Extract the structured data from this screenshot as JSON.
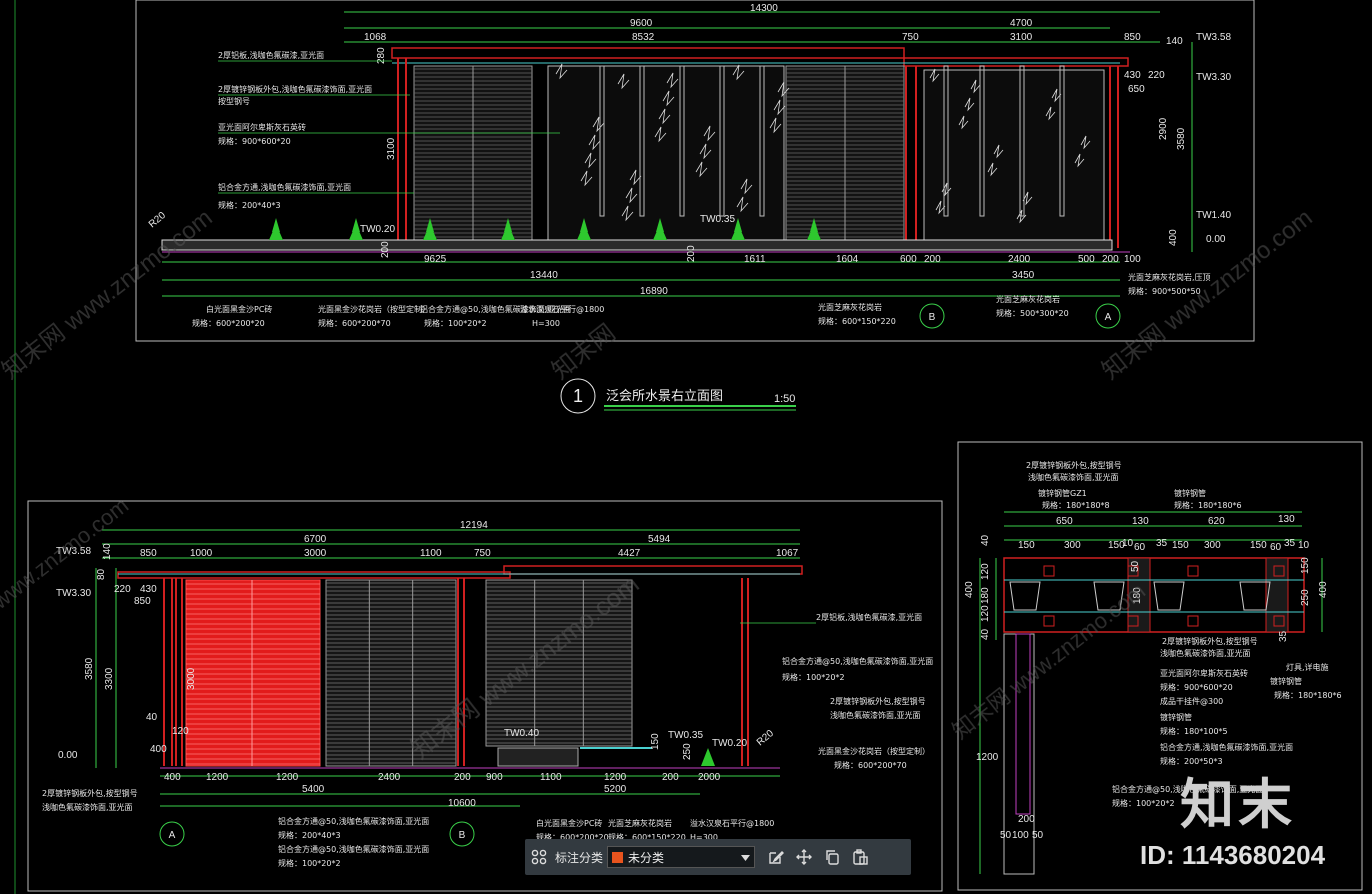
{
  "drawing": {
    "view1": {
      "number": "1",
      "title": "泛会所水景右立面图",
      "scale": "1:50",
      "top_dims": [
        "14300",
        "9600",
        "4700",
        "1068",
        "8532",
        "750",
        "3100",
        "850",
        "140"
      ],
      "levels": [
        "TW3.58",
        "TW3.30",
        "TW1.40",
        "0.00",
        "TW0.20",
        "TW0.35"
      ],
      "side_dims": [
        "3580",
        "2900",
        "430",
        "220",
        "650",
        "400",
        "3100",
        "280"
      ],
      "bottom_dims": [
        "9625",
        "1611",
        "1604",
        "600",
        "200",
        "2400",
        "500",
        "200",
        "13440",
        "3450",
        "16890",
        "100",
        "200",
        "200",
        "R20"
      ],
      "notes": [
        "2厚铝板,浅咖色氟碳漆,亚光面",
        "2厚镀锌钢板外包,浅咖色氟碳漆饰面,亚光面",
        "按型钢号",
        "亚光面阿尔卑斯灰石英砖",
        "规格：900*600*20",
        "铝合金方通,浅咖色氟碳漆饰面,亚光面",
        "规格：200*40*3",
        "白光面黑金沙PC砖",
        "规格：600*200*20",
        "光面黑金沙花岗岩（按型定制）",
        "规格：600*200*70",
        "铝合金方通@50,浅咖色氟碳漆饰面,亚光面",
        "规格：100*20*2",
        "溢水汉泉石平行@1800",
        "H=300",
        "光面芝麻灰花岗岩",
        "规格：600*150*220",
        "光面芝麻灰花岗岩",
        "规格：500*300*20",
        "光面芝麻灰花岗岩,压顶",
        "规格：900*500*50"
      ],
      "axes": [
        "B",
        "A"
      ]
    },
    "view2": {
      "top_dims": [
        "12194",
        "6700",
        "5494",
        "850",
        "1000",
        "3000",
        "1100",
        "750",
        "4427",
        "1067",
        "140",
        "80",
        "220",
        "430",
        "850"
      ],
      "levels": [
        "TW3.58",
        "TW3.30",
        "0.00",
        "TW0.40",
        "TW0.35",
        "TW0.20"
      ],
      "side_dims": [
        "3580",
        "3300",
        "3000",
        "400",
        "120",
        "40",
        "150",
        "250"
      ],
      "bottom_dims": [
        "400",
        "1200",
        "1200",
        "2400",
        "200",
        "900",
        "1100",
        "1200",
        "200",
        "2000",
        "5400",
        "5200",
        "10600",
        "R20"
      ],
      "notes": [
        "2厚镀锌钢板外包,按型钢号",
        "浅咖色氟碳漆饰面,亚光面",
        "铝合金方通@50,浅咖色氟碳漆饰面,亚光面",
        "规格：200*40*3",
        "铝合金方通@50,浅咖色氟碳漆饰面,亚光面",
        "规格：100*20*2",
        "白光面黑金沙PC砖",
        "规格：600*200*20",
        "光面芝麻灰花岗岩",
        "规格：600*150*220",
        "溢水汉泉石平行@1800",
        "H=300",
        "2厚铝板,浅咖色氟碳漆,亚光面",
        "铝合金方通@50,浅咖色氟碳漆饰面,亚光面",
        "规格：100*20*2",
        "2厚镀锌钢板外包,按型钢号",
        "浅咖色氟碳漆饰面,亚光面",
        "光面黑金沙花岗岩（按型定制）",
        "规格：600*200*70"
      ],
      "axes": [
        "A",
        "B"
      ]
    },
    "view3": {
      "top_dims": [
        "650",
        "620",
        "130",
        "150",
        "300",
        "150",
        "10",
        "60",
        "35",
        "150",
        "300",
        "150",
        "60",
        "35",
        "10",
        "130"
      ],
      "side_dims": [
        "40",
        "120",
        "180",
        "120",
        "40",
        "400",
        "50",
        "180",
        "150",
        "250",
        "400",
        "35",
        "1200",
        "200",
        "50",
        "100",
        "50"
      ],
      "notes": [
        "2厚镀锌钢板外包,按型钢号",
        "浅咖色氟碳漆饰面,亚光面",
        "镀锌钢管GZ1",
        "规格：180*180*8",
        "镀锌钢管",
        "规格：180*180*6",
        "2厚镀锌钢板外包,按型钢号",
        "浅咖色氟碳漆饰面,亚光面",
        "亚光面阿尔卑斯灰石英砖",
        "规格：900*600*20",
        "成品干挂件@300",
        "灯具,详电施",
        "镀锌钢管",
        "规格：180*180*6",
        "镀锌钢管",
        "规格：180*100*5",
        "铝合金方通,浅咖色氟碳漆饰面,亚光面",
        "规格：200*50*3",
        "铝合金方通@50,浅咖色氟碳漆饰面,亚光面",
        "规格：100*20*2"
      ]
    },
    "watermarks": [
      "知末网 www.znzmo.com",
      "www.znzmo.com",
      "知末网"
    ]
  },
  "toolbar": {
    "grid_icon": "grid-icon",
    "category_label": "标注分类",
    "layer_value": "未分类",
    "layer_color": "#e8541e",
    "tools": [
      "edit-icon",
      "move-icon",
      "copy-icon",
      "paste-icon"
    ]
  },
  "brand": {
    "logo_text": "知末",
    "id_text": "ID: 1143680204"
  }
}
